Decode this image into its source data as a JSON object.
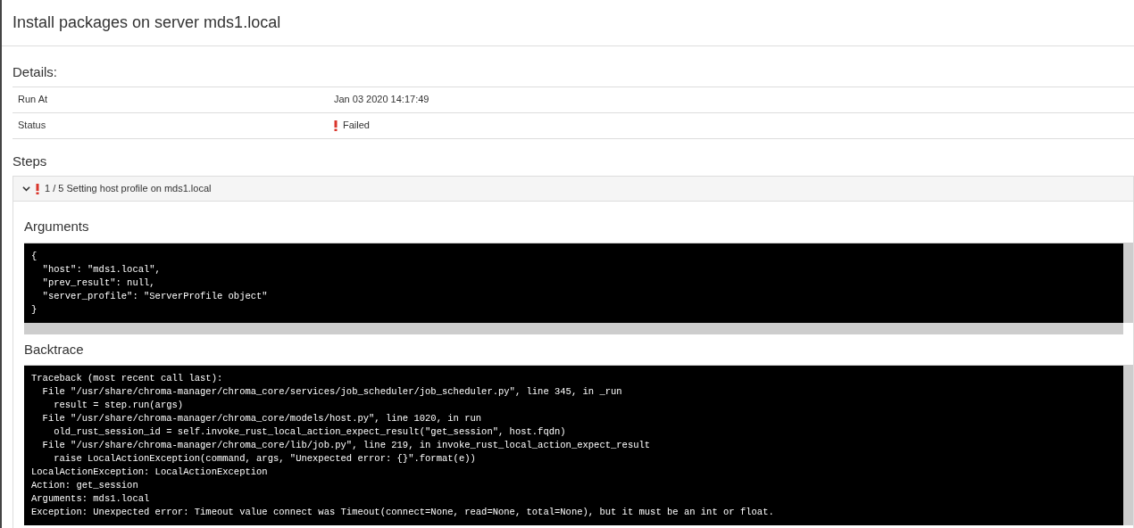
{
  "title": "Install packages on server mds1.local",
  "details": {
    "heading": "Details:",
    "rows": [
      {
        "kind": "text",
        "label": "Run At",
        "value": "Jan 03 2020 14:17:49"
      },
      {
        "kind": "status",
        "label": "Status",
        "value": "Failed",
        "failed": true
      }
    ]
  },
  "steps": {
    "heading": "Steps",
    "items": [
      {
        "label": "1 / 5 Setting host profile on mds1.local",
        "failed": true,
        "expanded": true,
        "arguments": {
          "heading": "Arguments",
          "lines": [
            "{",
            "  \"host\": \"mds1.local\",",
            "  \"prev_result\": null,",
            "  \"server_profile\": \"ServerProfile object\"",
            "}"
          ]
        },
        "backtrace": {
          "heading": "Backtrace",
          "lines": [
            "Traceback (most recent call last):",
            "  File \"/usr/share/chroma-manager/chroma_core/services/job_scheduler/job_scheduler.py\", line 345, in _run",
            "    result = step.run(args)",
            "  File \"/usr/share/chroma-manager/chroma_core/models/host.py\", line 1020, in run",
            "    old_rust_session_id = self.invoke_rust_local_action_expect_result(\"get_session\", host.fqdn)",
            "  File \"/usr/share/chroma-manager/chroma_core/lib/job.py\", line 219, in invoke_rust_local_action_expect_result",
            "    raise LocalActionException(command, args, \"Unexpected error: {}\".format(e))",
            "LocalActionException: LocalActionException",
            "Action: get_session",
            "Arguments: mds1.local",
            "Exception: Unexpected error: Timeout value connect was Timeout(connect=None, read=None, total=None), but it must be an int or float."
          ]
        }
      }
    ]
  }
}
